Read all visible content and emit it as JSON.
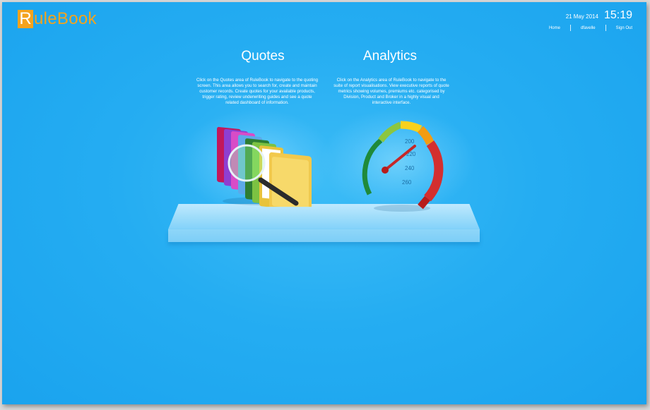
{
  "brand": {
    "initial": "R",
    "rest": "uleBook",
    "accent": "#f4a31d"
  },
  "header": {
    "date": "21 May 2014",
    "time": "15:19",
    "nav": {
      "home": "Home",
      "user": "dfavelle",
      "sign_out": "Sign Out"
    }
  },
  "quotes": {
    "title": "Quotes",
    "description": "Click on the Quotes area of RuleBook to navigate to the quoting screen. This area allows you to search for, create and maintain customer records. Create quotes for your available products, trigger rating, review underwriting guides and see a quote related dashboard of information.",
    "icon": "folders-magnifier-icon"
  },
  "analytics": {
    "title": "Analytics",
    "description": "Click on the Analytics area of RuleBook to navigate to the suite of report visualisations. View executive reports of quote metrics showing volumes, premiums etc. categorised by Division, Product and Broker in a highly visual and interactive interface.",
    "icon": "speedometer-icon",
    "gauge_labels": [
      "200",
      "220",
      "240",
      "260"
    ]
  },
  "colors": {
    "background": "#25adf2",
    "text": "#ffffff"
  }
}
